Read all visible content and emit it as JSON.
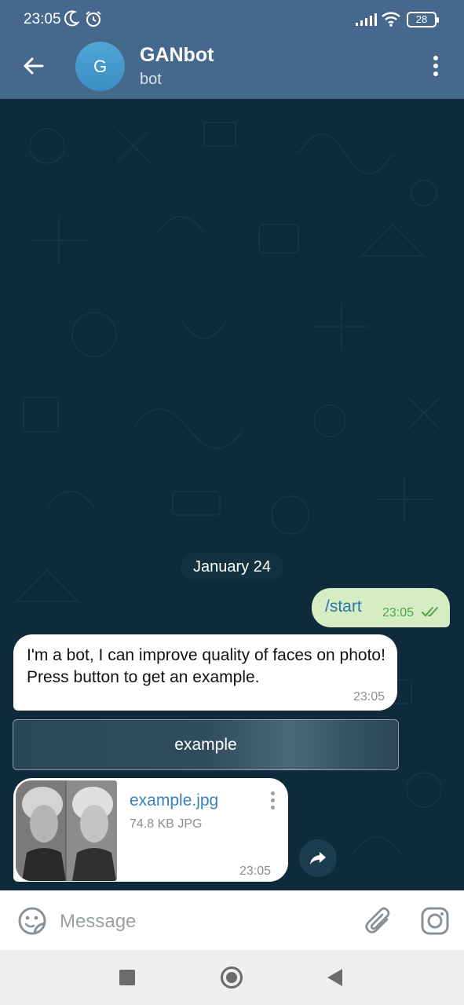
{
  "status_bar": {
    "time": "23:05",
    "battery": "28",
    "icons": [
      "moon-icon",
      "alarm-icon",
      "signal-icon",
      "wifi-icon",
      "battery-icon"
    ]
  },
  "header": {
    "avatar_letter": "G",
    "title": "GANbot",
    "subtitle": "bot",
    "colors": {
      "bar": "#45688c",
      "avatar": "#3a8dc2"
    }
  },
  "chat": {
    "date": "January 24",
    "messages": [
      {
        "direction": "out",
        "text": "/start",
        "time": "23:05",
        "status": "read"
      },
      {
        "direction": "in",
        "text": "I'm a bot, I can improve quality of faces on photo! Press button to get an example.",
        "time": "23:05"
      }
    ],
    "inline_button": "example",
    "file": {
      "name": "example.jpg",
      "size": "74.8 KB JPG",
      "time": "23:05"
    },
    "colors": {
      "background": "#0e2a3b",
      "outgoing_bubble": "#d6ecc3",
      "incoming_bubble": "#ffffff"
    }
  },
  "input": {
    "placeholder": "Message",
    "value": ""
  },
  "nav": {
    "buttons": [
      "recents-button",
      "home-button",
      "back-button"
    ]
  }
}
